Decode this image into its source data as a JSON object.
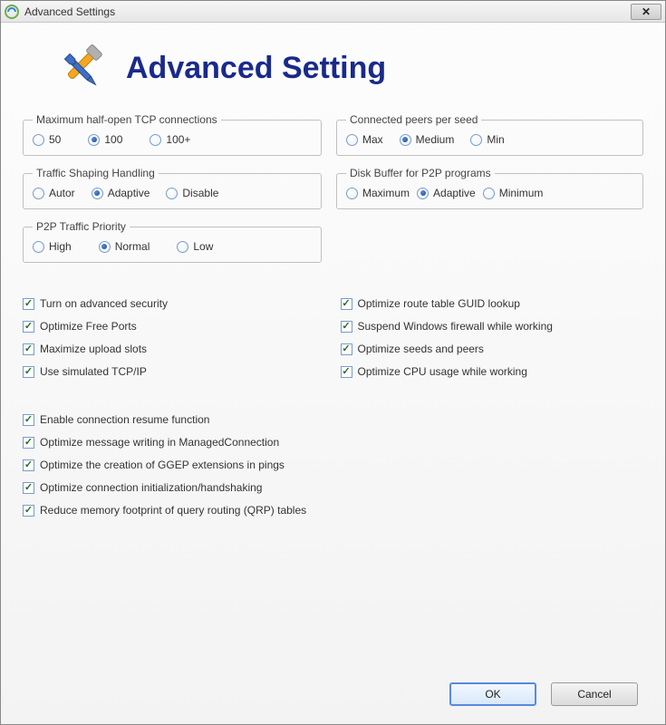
{
  "window": {
    "title": "Advanced Settings"
  },
  "header": {
    "title": "Advanced Setting"
  },
  "groups": {
    "tcp": {
      "legend": "Maximum half-open TCP connections",
      "options": [
        "50",
        "100",
        "100+"
      ],
      "selected": 1
    },
    "peers": {
      "legend": "Connected peers per seed",
      "options": [
        "Max",
        "Medium",
        "Min"
      ],
      "selected": 1
    },
    "traffic": {
      "legend": "Traffic Shaping Handling",
      "options": [
        "Autor",
        "Adaptive",
        "Disable"
      ],
      "selected": 1
    },
    "disk": {
      "legend": "Disk Buffer for P2P programs",
      "options": [
        "Maximum",
        "Adaptive",
        "Minimum"
      ],
      "selected": 1
    },
    "priority": {
      "legend": "P2P Traffic Priority",
      "options": [
        "High",
        "Normal",
        "Low"
      ],
      "selected": 1
    }
  },
  "checks": {
    "col1": [
      "Turn on advanced security",
      "Optimize Free Ports",
      "Maximize upload slots",
      "Use simulated TCP/IP"
    ],
    "col2": [
      "Optimize route table GUID lookup",
      "Suspend Windows firewall while working",
      "Optimize seeds and peers",
      "Optimize CPU usage while working"
    ],
    "list": [
      "Enable connection resume function",
      "Optimize message writing in ManagedConnection",
      "Optimize the creation of GGEP extensions in pings",
      "Optimize connection initialization/handshaking",
      "Reduce memory footprint of query routing (QRP) tables"
    ]
  },
  "buttons": {
    "ok": "OK",
    "cancel": "Cancel"
  }
}
